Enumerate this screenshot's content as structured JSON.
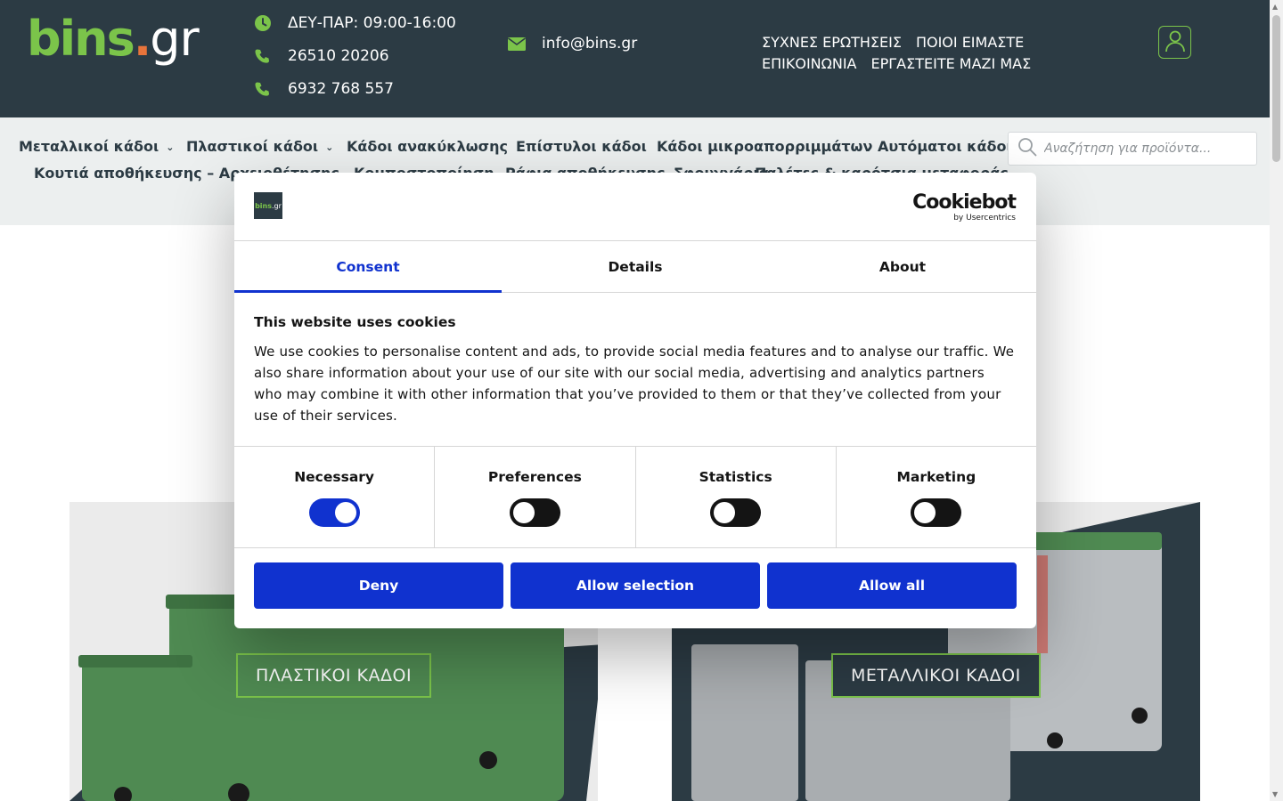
{
  "header": {
    "logo": {
      "part1": "bins",
      "dot": ".",
      "part2": "gr"
    },
    "hours": "ΔΕΥ-ΠΑΡ: 09:00-16:00",
    "phone1": "26510 20206",
    "phone2": "6932 768 557",
    "email": "info@bins.gr",
    "links": [
      "ΣΥΧΝΕΣ ΕΡΩΤΗΣΕΙΣ",
      "ΠΟΙΟΙ ΕΙΜΑΣΤΕ",
      "ΕΠΙΚΟΙΝΩΝΙΑ",
      "ΕΡΓΑΣΤΕΙΤΕ ΜΑΖΙ ΜΑΣ"
    ],
    "account_icon": "user-icon"
  },
  "nav": {
    "row1": [
      "Μεταλλικοί κάδοι",
      "Πλαστικοί κάδοι",
      "Κάδοι ανακύκλωσης",
      "Επίστυλοι κάδοι",
      "Κάδοι μικροαπορριμμάτων",
      "Αυτόματοι κάδοι"
    ],
    "row2": [
      "Κουτιά αποθήκευσης – Αρχειοθέτησης",
      "Κομποστοποίηση",
      "Ράφια αποθήκευσης",
      "Σφουγγάρια",
      "Παλέτες & καρότσια μεταφοράς"
    ],
    "search_placeholder": "Αναζήτηση για προϊόντα..."
  },
  "cards": {
    "plastic_label": "ΠΛΑΣΤΙΚΟΙ ΚΑΔΟΙ",
    "metal_label": "ΜΕΤΑΛΛΙΚΟΙ ΚΑΔΟΙ"
  },
  "cookie": {
    "logo_text": {
      "a": "bins",
      "b": ".gr"
    },
    "brand": "Cookiebot",
    "brand_sub": "by Usercentrics",
    "tabs": [
      "Consent",
      "Details",
      "About"
    ],
    "title": "This website uses cookies",
    "text": "We use cookies to personalise content and ads, to provide social media features and to analyse our traffic. We also share information about your use of our site with our social media, advertising and analytics partners who may combine it with other information that you’ve provided to them or that they’ve collected from your use of their services.",
    "toggles": [
      {
        "label": "Necessary",
        "on": true
      },
      {
        "label": "Preferences",
        "on": false
      },
      {
        "label": "Statistics",
        "on": false
      },
      {
        "label": "Marketing",
        "on": false
      }
    ],
    "buttons": {
      "deny": "Deny",
      "selection": "Allow selection",
      "all": "Allow all"
    }
  },
  "colors": {
    "header_bg": "#2c3b44",
    "brand_green": "#7bc44a",
    "cookie_blue": "#1032cf"
  }
}
